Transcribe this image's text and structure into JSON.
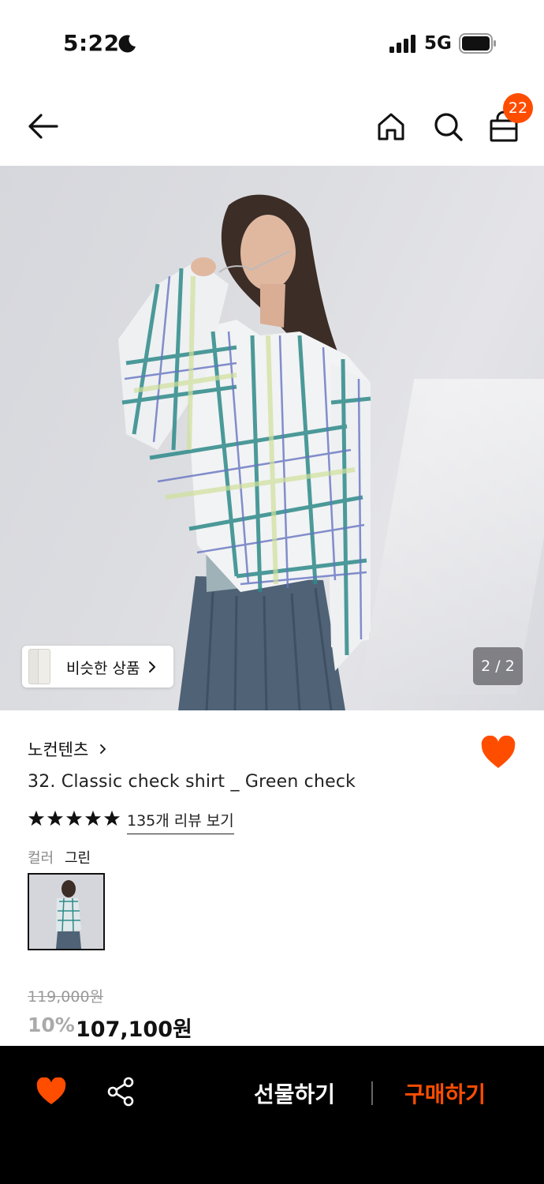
{
  "status_bar": {
    "time": "5:22",
    "network": "5G"
  },
  "header": {
    "cart_count": "22"
  },
  "gallery": {
    "similar_label": "비슷한 상품",
    "page_indicator": "2 / 2"
  },
  "product": {
    "brand": "노컨텐츠",
    "title": "32. Classic check shirt _ Green check",
    "rating_stars": 5,
    "review_link": "135개 리뷰 보기",
    "color_label": "컬러",
    "color_value": "그린",
    "original_price": "119,000원",
    "discount": "10%",
    "sale_price": "107,100원"
  },
  "bottom_bar": {
    "gift_label": "선물하기",
    "buy_label": "구매하기"
  },
  "colors": {
    "accent": "#ff4d00",
    "bottom_bar_bg": "#000000"
  },
  "icons": [
    "moon-icon",
    "signal-icon",
    "battery-icon",
    "back-arrow-icon",
    "home-icon",
    "search-icon",
    "shopping-bag-icon",
    "chevron-right-icon",
    "heart-icon",
    "star-icon",
    "share-icon"
  ]
}
